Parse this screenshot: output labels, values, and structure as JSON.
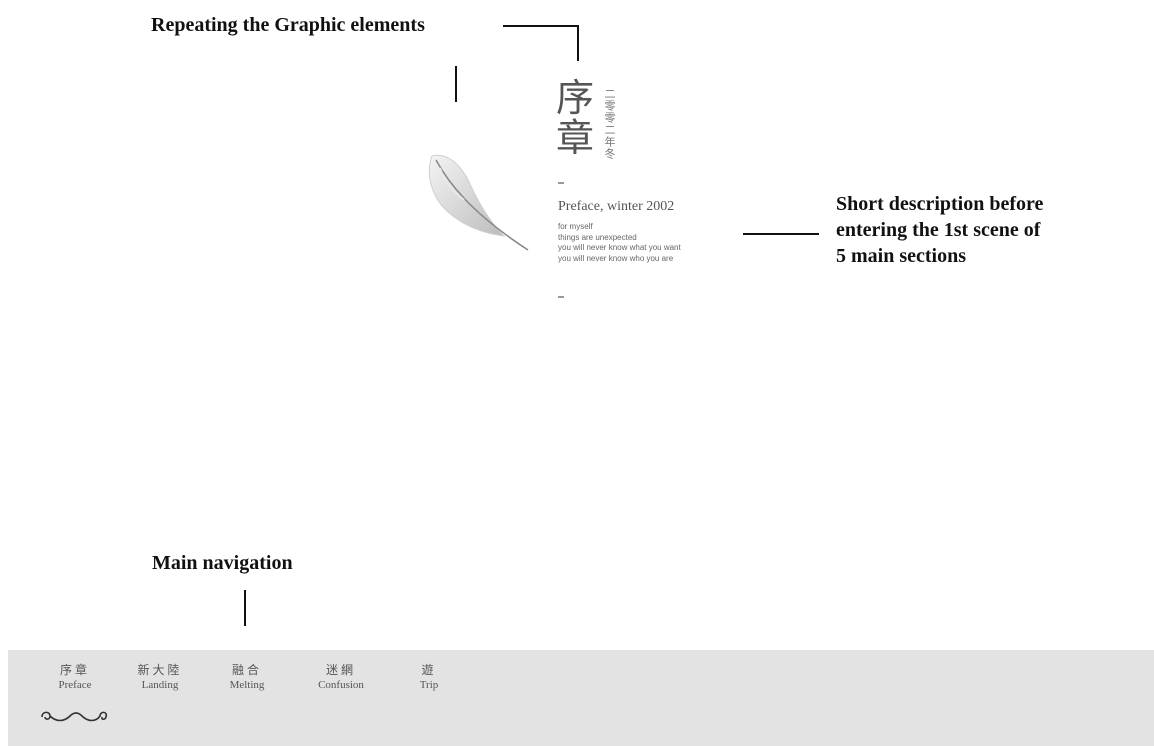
{
  "annotations": {
    "repeating": "Repeating the Graphic elements",
    "description_lines": [
      "Short description before",
      "entering the 1st scene of",
      "5 main sections"
    ],
    "navigation": "Main navigation"
  },
  "preface": {
    "title_cjk": "序章",
    "title_vertical": "二零零二年冬",
    "heading": "Preface, winter 2002",
    "body": [
      "for myself",
      "things are unexpected",
      "you will never know what you want",
      "you will never know who you are"
    ]
  },
  "navigation": {
    "items": [
      {
        "cjk": "序章",
        "en": "Preface"
      },
      {
        "cjk": "新大陸",
        "en": "Landing"
      },
      {
        "cjk": "融合",
        "en": "Melting"
      },
      {
        "cjk": "迷網",
        "en": "Confusion"
      },
      {
        "cjk": "遊",
        "en": "Trip"
      }
    ]
  },
  "icons": {
    "feather": "feather-icon",
    "flourish": "flourish-ornament-icon"
  },
  "colors": {
    "nav_background": "#e3e3e3",
    "text_gray": "#555555"
  }
}
